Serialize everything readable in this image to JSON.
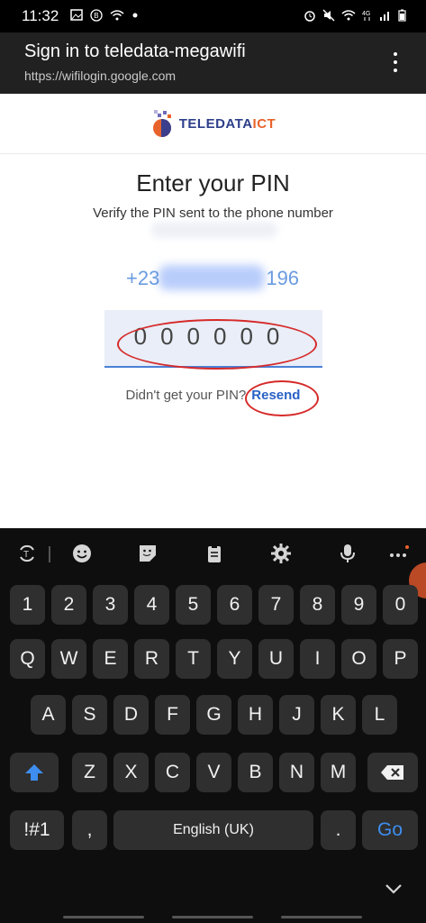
{
  "status": {
    "time": "11:32",
    "left_icons": [
      "image-icon",
      "b-badge-icon",
      "wifi-icon",
      "dot-icon"
    ],
    "right_icons": [
      "alarm-icon",
      "mute-icon",
      "wifi-icon",
      "4g-icon",
      "signal-icon",
      "battery-icon"
    ]
  },
  "appbar": {
    "title": "Sign in to teledata-megawifi",
    "url": "https://wifilogin.google.com"
  },
  "logo": {
    "name": "TELEDATA",
    "suffix": "ICT"
  },
  "page": {
    "heading": "Enter your PIN",
    "subtext": "Verify the PIN sent to the phone number",
    "phone_prefix": "+23",
    "phone_suffix": "196",
    "pin_value": "000000",
    "resend_prompt": "Didn't get your PIN?",
    "resend_label": "Resend"
  },
  "keyboard": {
    "numbers": [
      "1",
      "2",
      "3",
      "4",
      "5",
      "6",
      "7",
      "8",
      "9",
      "0"
    ],
    "row1": [
      "Q",
      "W",
      "E",
      "R",
      "T",
      "Y",
      "U",
      "I",
      "O",
      "P"
    ],
    "row2": [
      "A",
      "S",
      "D",
      "F",
      "G",
      "H",
      "J",
      "K",
      "L"
    ],
    "row3": [
      "Z",
      "X",
      "C",
      "V",
      "B",
      "N",
      "M"
    ],
    "symbols_label": "!#1",
    "comma": ",",
    "space_label": "English (UK)",
    "period": ".",
    "go_label": "Go"
  },
  "colors": {
    "accent": "#2a62c6",
    "ring": "#d62a2a",
    "logo_orange": "#e8632b",
    "logo_blue": "#2d3f8a"
  }
}
